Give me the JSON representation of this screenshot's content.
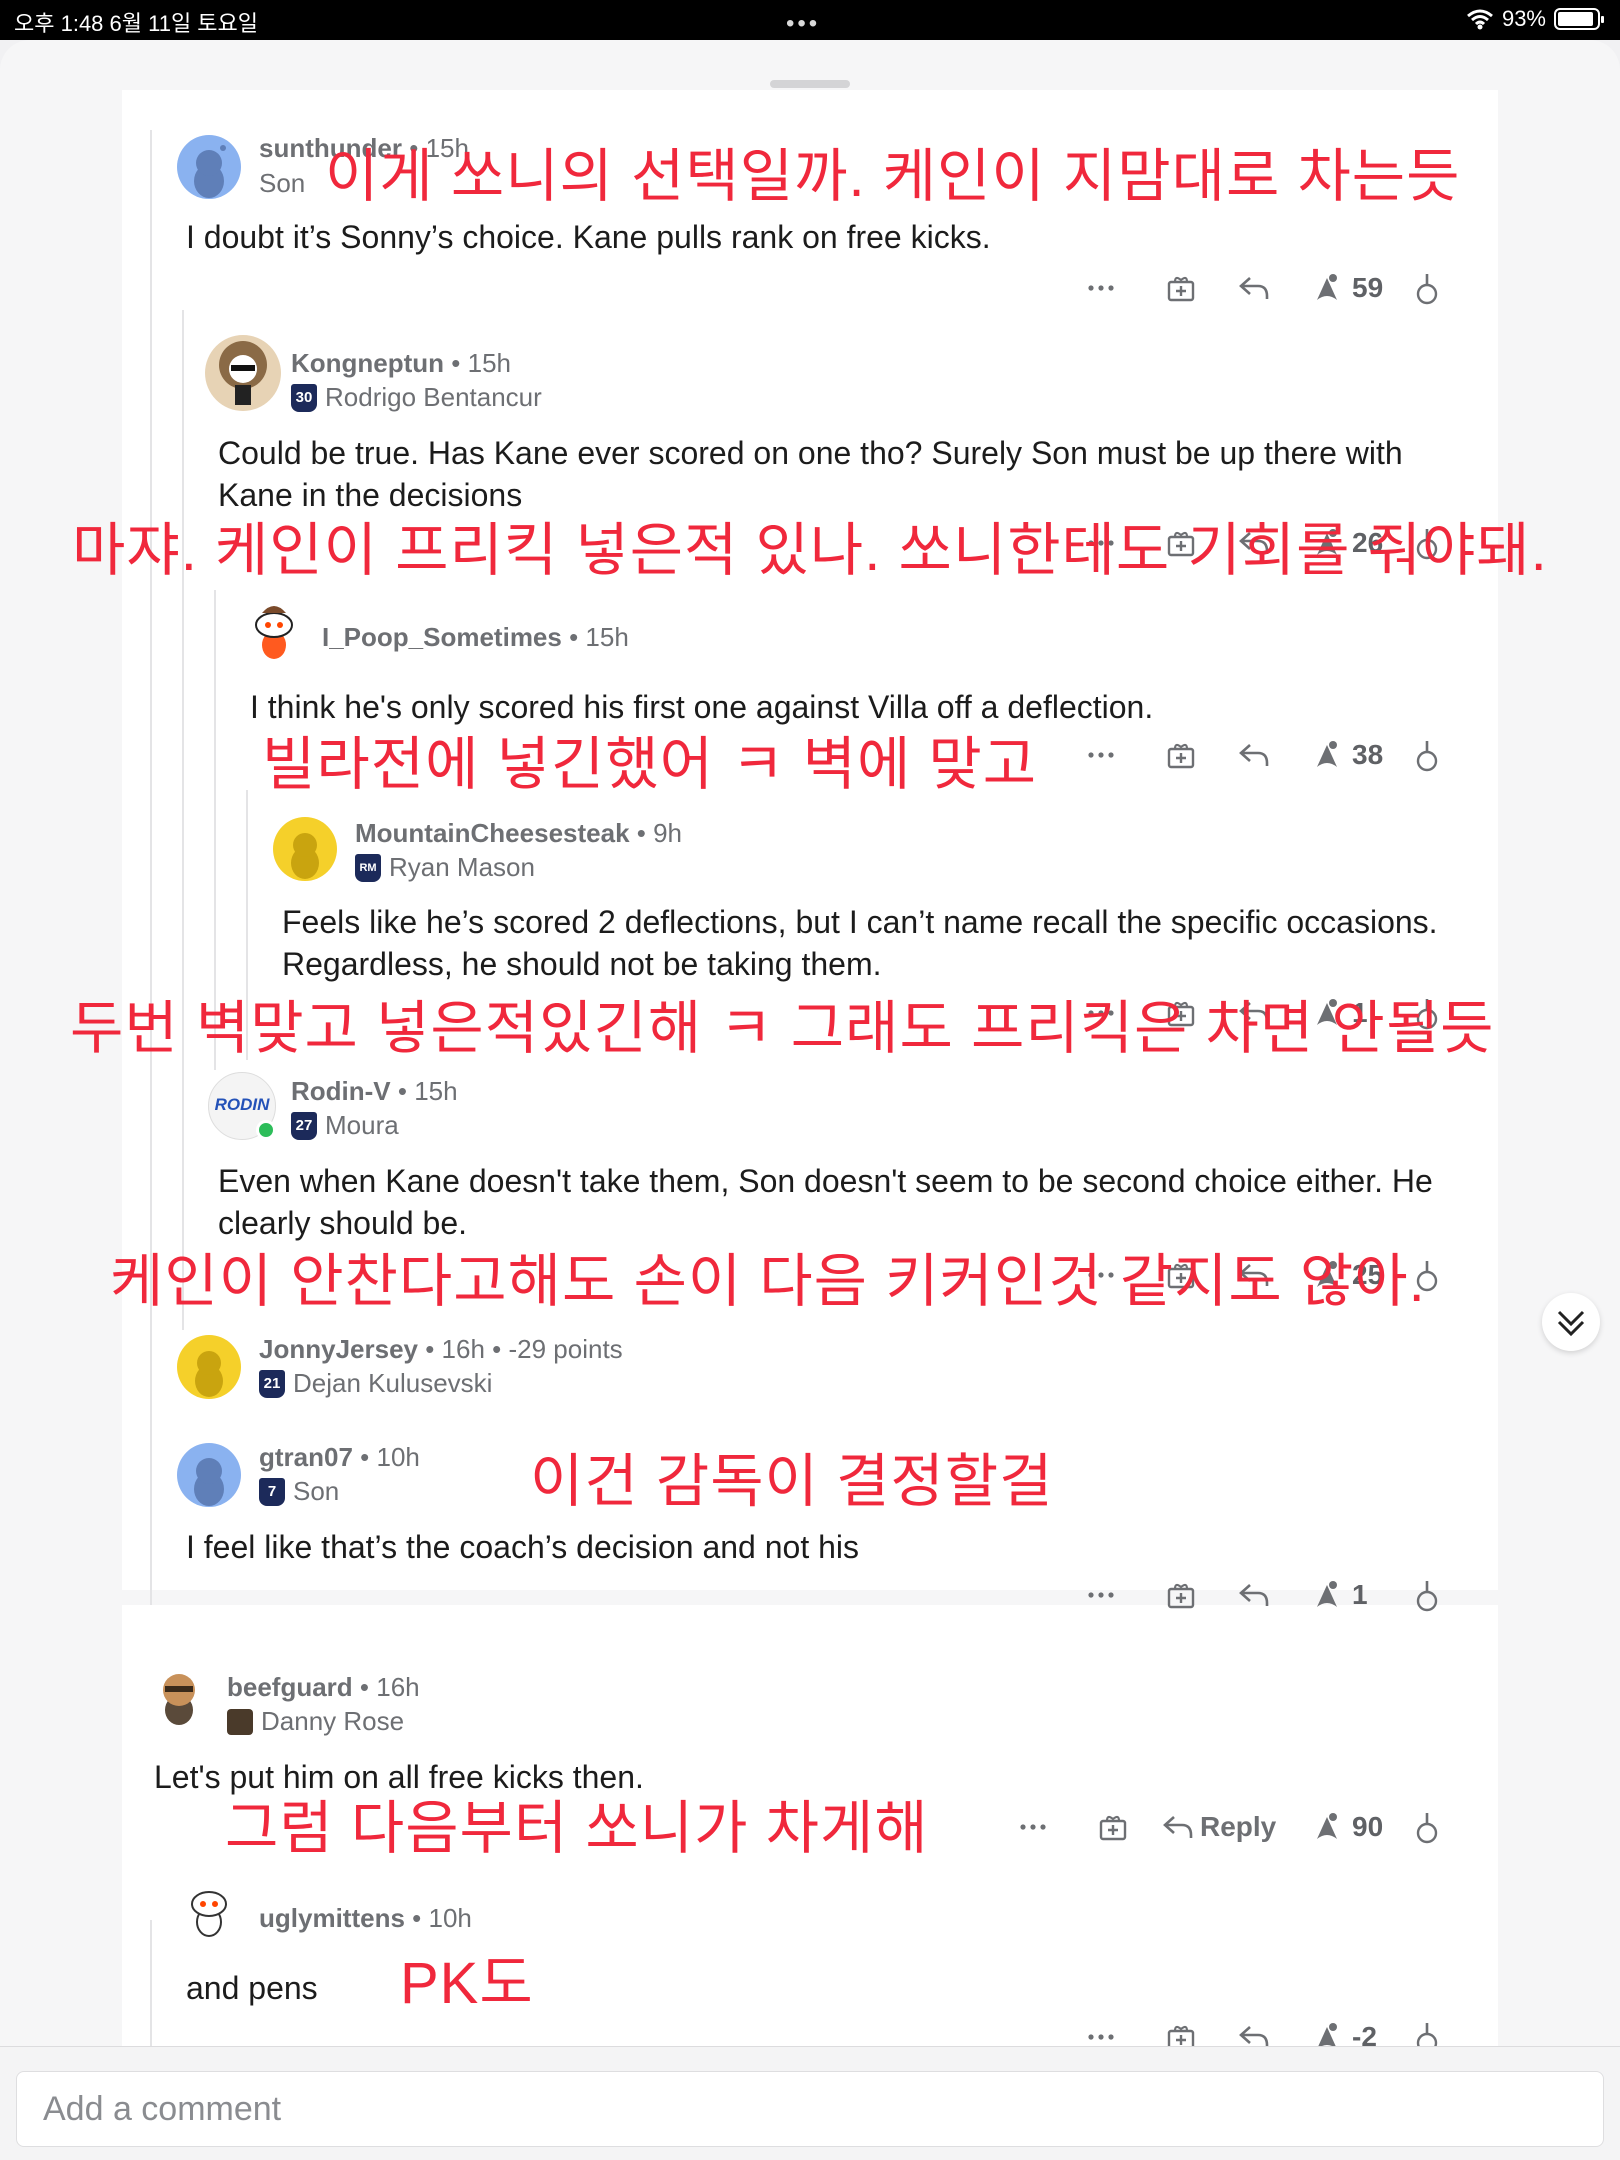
{
  "status": {
    "time": "오후 1:48   6월 11일 토요일",
    "battery": "93%"
  },
  "composer": {
    "placeholder": "Add a comment"
  },
  "comments": [
    {
      "user": "sunthunder",
      "age": "15h",
      "flair": "Son",
      "body": "I doubt it’s Sonny’s choice. Kane pulls rank on free kicks.",
      "votes": "59"
    },
    {
      "user": "Kongneptun",
      "age": "15h",
      "flair": "Rodrigo Bentancur",
      "flair_num": "30",
      "body": "Could be true. Has Kane ever scored on one tho? Surely Son must be up there with Kane in the decisions",
      "votes": "26"
    },
    {
      "user": "I_Poop_Sometimes",
      "age": "15h",
      "body": "I think he's only scored his first one against Villa off a deflection.",
      "votes": "38"
    },
    {
      "user": "MountainCheesesteak",
      "age": "9h",
      "flair": "Ryan Mason",
      "flair_num": "RM",
      "body": "Feels like he’s scored 2 deflections, but I can’t name recall the specific occasions. Regardless, he should not be taking them.",
      "votes": "1"
    },
    {
      "user": "Rodin-V",
      "age": "15h",
      "flair": "Moura",
      "flair_num": "27",
      "avatar_text": "RODIN",
      "body": "Even when Kane doesn't take them, Son doesn't seem to be second choice either. He clearly should be.",
      "votes": "25"
    },
    {
      "user": "JonnyJersey",
      "age": "16h",
      "points": "-29 points",
      "flair": "Dejan Kulusevski",
      "flair_num": "21"
    },
    {
      "user": "gtran07",
      "age": "10h",
      "flair": "Son",
      "flair_num": "7",
      "body": "I feel like that’s the coach’s decision and not his",
      "votes": "1"
    },
    {
      "user": "beefguard",
      "age": "16h",
      "flair": "Danny Rose",
      "body": "Let's put him on all free kicks then.",
      "votes": "90",
      "reply_label": "Reply"
    },
    {
      "user": "uglymittens",
      "age": "10h",
      "body": "and pens",
      "votes": "-2"
    }
  ],
  "overlays": [
    "이게 쏘니의 선택일까. 케인이 지맘대로 차는듯",
    "마쟈. 케인이 프리킥 넣은적 있나. 쏘니한테도 기회를 줘야돼.",
    "빌라전에 넣긴했어 ㅋ 벽에 맞고",
    "두번 벽맞고 넣은적있긴해 ㅋ 그래도 프리킥은 차면 안될듯",
    "케인이 안찬다고해도 손이 다음 키커인것 같지도 않아.",
    "이건 감독이 결정할걸",
    "그럼 다음부터 쏘니가 차게해",
    "PK도"
  ],
  "colors": {
    "overlay_text": "#f0283c",
    "badge_navy": "#1c2a5a"
  },
  "icons": [
    "more-icon",
    "award-icon",
    "reply-icon",
    "upvote-icon",
    "downvote-icon",
    "scroll-down-icon",
    "wifi-icon",
    "battery-icon",
    "snoo-avatar-icon"
  ]
}
